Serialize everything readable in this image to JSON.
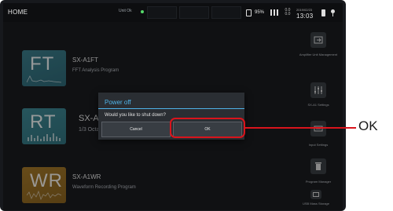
{
  "statusbar": {
    "home": "HOME",
    "unit_status": "Unit Ok",
    "battery_percent": "95%",
    "wifi": "0.0 0.0",
    "date": "2019/02/23",
    "time": "13:03"
  },
  "programs": [
    {
      "abbr": "FT",
      "name": "SX-A1FT",
      "description": "FFT Analysis Program",
      "color": "#3c7e8c"
    },
    {
      "abbr": "RT",
      "name": "SX-A1",
      "description": "1/3 Octa",
      "color": "#3f8a96"
    },
    {
      "abbr": "WR",
      "name": "SX-A1WR",
      "description": "Waveform Recording Program",
      "color": "#a67a2a"
    }
  ],
  "side_menu": [
    {
      "label": "Amplifier Unit Management",
      "icon": "amplifier-icon"
    },
    {
      "label": "SX-A1 Settings",
      "icon": "sliders-icon"
    },
    {
      "label": "Input Settings",
      "icon": "input-icon"
    },
    {
      "label": "Program Manager",
      "icon": "trash-icon"
    },
    {
      "label": "USB Mass Storage",
      "icon": "usb-icon"
    }
  ],
  "dialog": {
    "title": "Power off",
    "message": "Would you like to shut down?",
    "cancel_label": "Cancel",
    "ok_label": "OK"
  },
  "annotation": {
    "label": "OK",
    "color": "#d9141c"
  }
}
